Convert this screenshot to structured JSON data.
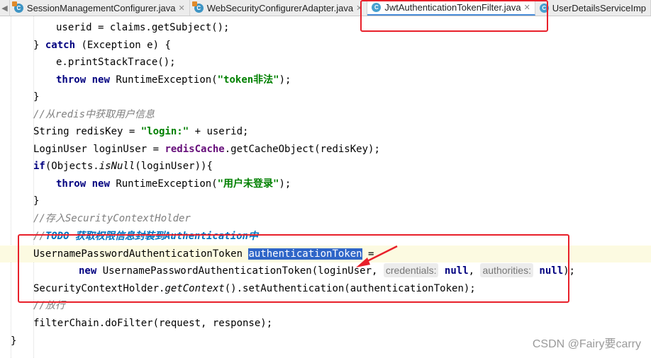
{
  "tabs": [
    {
      "label": "SessionManagementConfigurer.java",
      "active": false
    },
    {
      "label": "WebSecurityConfigurerAdapter.java",
      "active": false
    },
    {
      "label": "JwtAuthenticationTokenFilter.java",
      "active": true
    },
    {
      "label": "UserDetailsServiceImp",
      "active": false
    }
  ],
  "tab_close": "✕",
  "tab_arrow": "◀",
  "code": {
    "l1": {
      "a": "userid = claims.getSubject();"
    },
    "l2": {
      "a": "} ",
      "kw": "catch",
      "b": " (Exception e) {"
    },
    "l3": {
      "a": "e.printStackTrace();"
    },
    "l4": {
      "kw1": "throw",
      "kw2": "new",
      "a": " RuntimeException(",
      "str": "\"token非法\"",
      "b": ");"
    },
    "l5": {
      "a": "}"
    },
    "l6": {
      "cmt": "//从redis中获取用户信息"
    },
    "l7": {
      "a": "String redisKey = ",
      "str": "\"login:\"",
      "b": " + userid;"
    },
    "l8": {
      "a": "LoginUser loginUser = ",
      "field": "redisCache",
      "b": ".getCacheObject(redisKey);"
    },
    "l9": {
      "kw": "if",
      "a": "(Objects.",
      "it": "isNull",
      "b": "(loginUser)){"
    },
    "l10": {
      "kw1": "throw",
      "kw2": "new",
      "a": " RuntimeException(",
      "str": "\"用户未登录\"",
      "b": ");"
    },
    "l11": {
      "a": "}"
    },
    "l12": {
      "cmt": "//存入SecurityContextHolder"
    },
    "l13": {
      "cmt": "//",
      "todo": "TODO 获取权限信息封装到Authentication中"
    },
    "l14": {
      "a": "UsernamePasswordAuthenticationToken ",
      "sel": "authenticationToken",
      "b": " ="
    },
    "l15": {
      "kw": "new",
      "a": " UsernamePasswordAuthenticationToken(loginUser, ",
      "hint1": "credentials:",
      "null1": "null",
      "sep": ", ",
      "hint2": "authorities:",
      "null2": "null",
      "b": ");"
    },
    "l16": {
      "a": "SecurityContextHolder.",
      "it": "getContext",
      "b": "().setAuthentication(authenticationToken);"
    },
    "l17": {
      "cmt": "//放行"
    },
    "l18": {
      "a": "filterChain.doFilter(request, response);"
    },
    "l19": {
      "a": "}"
    }
  },
  "watermark": "CSDN @Fairy要carry",
  "colors": {
    "annotation": "#e8202a",
    "selection": "#2f66c8",
    "keyword": "#000080",
    "string": "#008000"
  }
}
